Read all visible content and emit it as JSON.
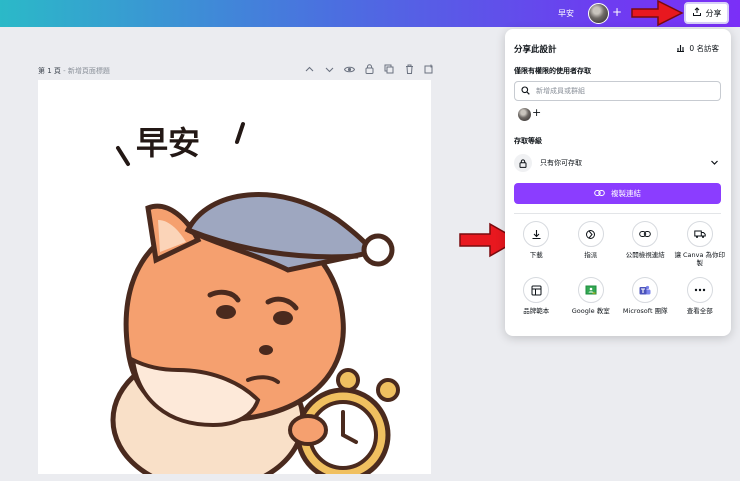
{
  "topbar": {
    "title": "早安",
    "plus": "+",
    "share_label": "分享"
  },
  "page": {
    "label": "第 1 頁",
    "separator": " - ",
    "title_placeholder": "新增頁面標題"
  },
  "artwork": {
    "text": "早安"
  },
  "share_panel": {
    "title": "分享此設計",
    "visitors": "0 名訪客",
    "people_section": "僅限有權限的使用者存取",
    "search_placeholder": "新增成員或群組",
    "avatar_plus": "+",
    "access_section": "存取等級",
    "access_value": "只有你可存取",
    "copy_link": "複製連結",
    "options": [
      {
        "label": "下載",
        "icon": "download-icon"
      },
      {
        "label": "指派",
        "icon": "assign-icon"
      },
      {
        "label": "公開檢視連結",
        "icon": "link-icon"
      },
      {
        "label": "讓 Canva 為你印製",
        "icon": "truck-icon"
      },
      {
        "label": "品牌範本",
        "icon": "template-icon"
      },
      {
        "label": "Google 教室",
        "icon": "google-classroom-icon"
      },
      {
        "label": "Microsoft 團隊",
        "icon": "teams-icon"
      },
      {
        "label": "查看全部",
        "icon": "more-icon"
      }
    ]
  },
  "colors": {
    "accent": "#8b3dff",
    "arrow": "#e8181f",
    "fox": "#f5a06f",
    "cap": "#9ea7c0",
    "clock": "#f0c060"
  }
}
